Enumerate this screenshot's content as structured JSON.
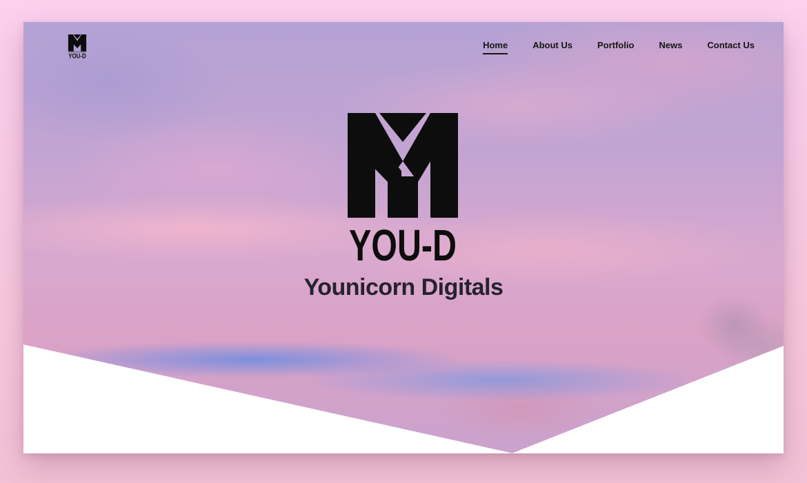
{
  "brand": {
    "logo_text": "YOU-D",
    "company_name": "Younicorn Digitals"
  },
  "nav": {
    "items": [
      {
        "label": "Home",
        "active": true
      },
      {
        "label": "About Us",
        "active": false
      },
      {
        "label": "Portfolio",
        "active": false
      },
      {
        "label": "News",
        "active": false
      },
      {
        "label": "Contact Us",
        "active": false
      }
    ]
  },
  "colors": {
    "page_background": "#f7cde6",
    "nav_text": "#151515",
    "title_text": "#26222f",
    "logo": "#0d0d0d",
    "wedge": "#ffffff"
  }
}
